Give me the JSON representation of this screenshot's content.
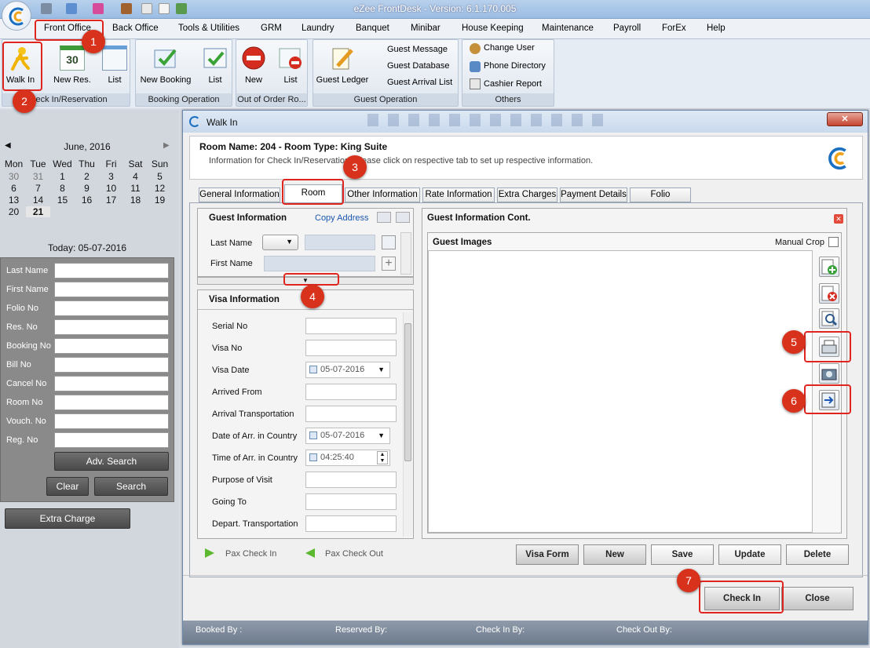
{
  "app": {
    "title": "eZee FrontDesk - Version: 6.1.170.005"
  },
  "menu": [
    "Front Office",
    "Back Office",
    "Tools & Utilities",
    "GRM",
    "Laundry",
    "Banquet",
    "Minibar",
    "House Keeping",
    "Maintenance",
    "Payroll",
    "ForEx",
    "Help"
  ],
  "ribbon": {
    "checkin": {
      "walk_in": "Walk In",
      "new_res": "New Res.",
      "list": "List",
      "label": "Check In/Reservation",
      "cal_day": "30"
    },
    "booking": {
      "new_booking": "New Booking",
      "list": "List",
      "label": "Booking Operation"
    },
    "ooo": {
      "new": "New",
      "list": "List",
      "label": "Out of Order Ro..."
    },
    "guest": {
      "ledger": "Guest Ledger",
      "message": "Guest Message",
      "database": "Guest Database",
      "arrival": "Guest Arrival List",
      "label": "Guest Operation"
    },
    "others": {
      "change_user": "Change User",
      "phone": "Phone Directory",
      "cashier": "Cashier Report",
      "label": "Others"
    }
  },
  "calendar": {
    "month": "June, 2016",
    "days": [
      "Mon",
      "Tue",
      "Wed",
      "Thu",
      "Fri",
      "Sat",
      "Sun"
    ],
    "weeks": [
      [
        "30",
        "31",
        "1",
        "2",
        "3",
        "4",
        "5"
      ],
      [
        "6",
        "7",
        "8",
        "9",
        "10",
        "11",
        "12"
      ],
      [
        "13",
        "14",
        "15",
        "16",
        "17",
        "18",
        "19"
      ],
      [
        "20",
        "21",
        "",
        "",
        "",
        "",
        ""
      ]
    ],
    "today": "Today: 05-07-2016"
  },
  "search": {
    "fields": [
      "Last Name",
      "First Name",
      "Folio No",
      "Res. No",
      "Booking No",
      "Bill No",
      "Cancel No",
      "Room No",
      "Vouch. No",
      "Reg. No"
    ],
    "adv": "Adv. Search",
    "clear": "Clear",
    "search": "Search",
    "extra": "Extra Charge"
  },
  "dialog": {
    "title": "Walk In",
    "room": "Room Name: 204 - Room Type: King Suite",
    "info": "Information for Check In/Reservation. Please click on respective tab to set up respective information.",
    "tabs": [
      "General Information",
      "Room Sharing",
      "Other Information",
      "Rate Information",
      "Extra Charges",
      "Payment Details",
      "Folio Summary"
    ],
    "guest_info": {
      "title": "Guest Information",
      "copy": "Copy Address",
      "last": "Last Name",
      "first": "First Name"
    },
    "visa": {
      "title": "Visa Information",
      "fields": [
        "Serial No",
        "Visa No",
        "Visa Date",
        "Arrived From",
        "Arrival Transportation",
        "Date of Arr. in Country",
        "Time of Arr. in Country",
        "Purpose of Visit",
        "Going To",
        "Depart. Transportation"
      ],
      "visa_date": "05-07-2016",
      "arr_date": "05-07-2016",
      "arr_time": "04:25:40"
    },
    "cont": {
      "title": "Guest Information Cont.",
      "images": "Guest Images",
      "crop": "Manual Crop"
    },
    "pax_in": "Pax Check In",
    "pax_out": "Pax Check Out",
    "buttons": {
      "visa_form": "Visa Form",
      "new": "New",
      "save": "Save",
      "update": "Update",
      "delete": "Delete",
      "check_in": "Check In",
      "close": "Close"
    },
    "footer": {
      "booked": "Booked By :",
      "reserved": "Reserved By:",
      "checkin": "Check In By:",
      "checkout": "Check Out By:"
    }
  },
  "markers": [
    "1",
    "2",
    "3",
    "4",
    "5",
    "6",
    "7"
  ],
  "colors": {
    "marker": "#d9321c",
    "accent": "#1a55b0"
  }
}
